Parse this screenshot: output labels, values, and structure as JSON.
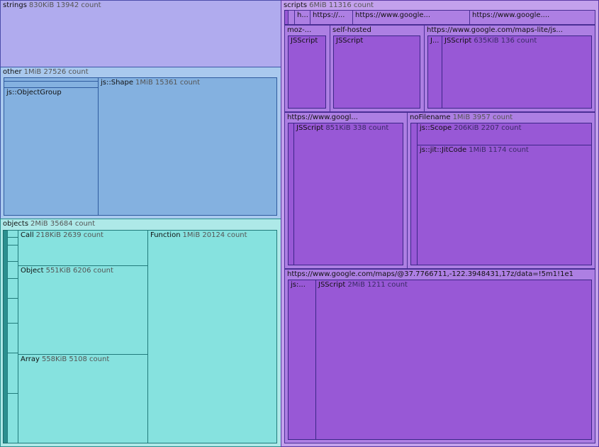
{
  "strings": {
    "name": "strings",
    "meta": "830KiB 13942 count"
  },
  "other": {
    "name": "other",
    "meta": "1MiB 27526 count",
    "object_group": {
      "name": "js::ObjectGroup"
    },
    "shape": {
      "name": "js::Shape",
      "meta": "1MiB 15361 count"
    }
  },
  "objects": {
    "name": "objects",
    "meta": "2MiB 35684 count",
    "call": {
      "name": "Call",
      "meta": "218KiB 2639 count"
    },
    "object": {
      "name": "Object",
      "meta": "551KiB 6206 count"
    },
    "array": {
      "name": "Array",
      "meta": "558KiB 5108 count"
    },
    "function": {
      "name": "Function",
      "meta": "1MiB 20124 count"
    }
  },
  "scripts": {
    "name": "scripts",
    "meta": "6MiB 11316 count",
    "top": [
      {
        "name": "h..."
      },
      {
        "name": "https://..."
      },
      {
        "name": "https://www.google..."
      },
      {
        "name": "https://www.google...."
      }
    ],
    "moz": {
      "name": "moz-...",
      "child": "JSScript"
    },
    "self_hosted": {
      "name": "self-hosted",
      "child": "JSScript"
    },
    "maps_lite": {
      "name": "https://www.google.com/maps-lite/js...",
      "child_small": "J...",
      "child": {
        "name": "JSScript",
        "meta": "635KiB 136 count"
      }
    },
    "googl": {
      "name": "https://www.googl...",
      "child": {
        "name": "JSScript",
        "meta": "851KiB 338 count"
      }
    },
    "no_filename": {
      "name": "noFilename",
      "meta": "1MiB 3957 count",
      "scope": {
        "name": "js::Scope",
        "meta": "206KiB 2207 count"
      },
      "jitcode": {
        "name": "js::jit::JitCode",
        "meta": "1MiB 1174 count"
      }
    },
    "maps_main": {
      "name": "https://www.google.com/maps/@37.7766711,-122.3948431,17z/data=!5m1!1e1",
      "child_small": "js:...",
      "child": {
        "name": "JSScript",
        "meta": "2MiB 1211 count"
      }
    }
  }
}
